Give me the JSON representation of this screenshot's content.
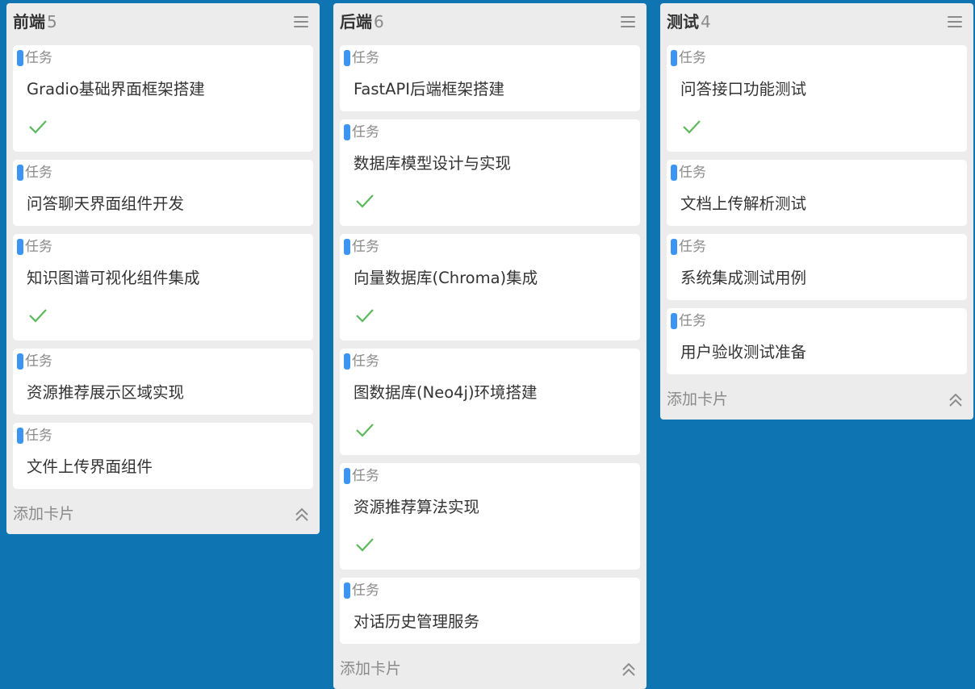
{
  "board": {
    "columns": [
      {
        "title": "前端",
        "count": "5",
        "add_label": "添加卡片",
        "cards": [
          {
            "tag": "任务",
            "title": "Gradio基础界面框架搭建",
            "done": true
          },
          {
            "tag": "任务",
            "title": "问答聊天界面组件开发",
            "done": false
          },
          {
            "tag": "任务",
            "title": "知识图谱可视化组件集成",
            "done": true
          },
          {
            "tag": "任务",
            "title": "资源推荐展示区域实现",
            "done": false
          },
          {
            "tag": "任务",
            "title": "文件上传界面组件",
            "done": false
          }
        ]
      },
      {
        "title": "后端",
        "count": "6",
        "add_label": "添加卡片",
        "cards": [
          {
            "tag": "任务",
            "title": "FastAPI后端框架搭建",
            "done": false
          },
          {
            "tag": "任务",
            "title": "数据库模型设计与实现",
            "done": true
          },
          {
            "tag": "任务",
            "title": "向量数据库(Chroma)集成",
            "done": true
          },
          {
            "tag": "任务",
            "title": "图数据库(Neo4j)环境搭建",
            "done": true
          },
          {
            "tag": "任务",
            "title": "资源推荐算法实现",
            "done": true
          },
          {
            "tag": "任务",
            "title": "对话历史管理服务",
            "done": false
          }
        ]
      },
      {
        "title": "测试",
        "count": "4",
        "add_label": "添加卡片",
        "cards": [
          {
            "tag": "任务",
            "title": "问答接口功能测试",
            "done": true
          },
          {
            "tag": "任务",
            "title": "文档上传解析测试",
            "done": false
          },
          {
            "tag": "任务",
            "title": "系统集成测试用例",
            "done": false
          },
          {
            "tag": "任务",
            "title": "用户验收测试准备",
            "done": false
          }
        ]
      }
    ]
  },
  "colors": {
    "background": "#0e74b2",
    "column": "#ececec",
    "card": "#ffffff",
    "tag": "#3c95f0",
    "check": "#5cb85c"
  },
  "icons": {
    "menu": "menu-icon",
    "done": "check-icon",
    "collapse": "chevron-double-up-icon"
  }
}
